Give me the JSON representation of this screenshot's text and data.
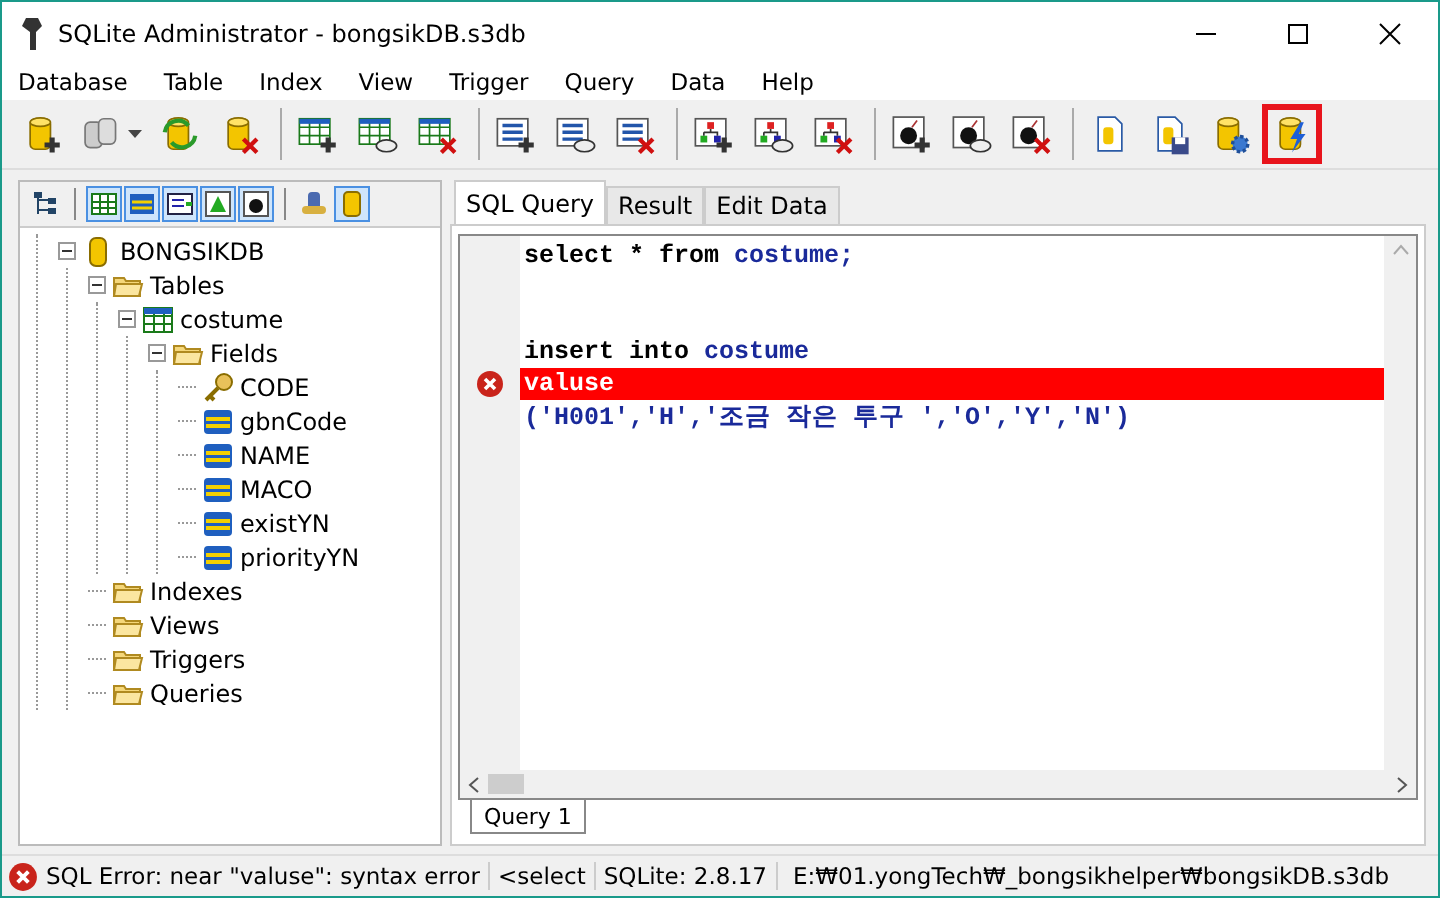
{
  "window": {
    "title": "SQLite Administrator - bongsikDB.s3db"
  },
  "menu": [
    "Database",
    "Table",
    "Index",
    "View",
    "Trigger",
    "Query",
    "Data",
    "Help"
  ],
  "toolbar": [
    {
      "kind": "db-add",
      "dropdown": false,
      "highlighted": false
    },
    {
      "kind": "dbs-none",
      "dropdown": true,
      "highlighted": false
    },
    {
      "kind": "db-refresh",
      "dropdown": false,
      "highlighted": false
    },
    {
      "kind": "db-delete",
      "dropdown": false,
      "highlighted": false
    },
    {
      "kind": "separator"
    },
    {
      "kind": "table-add",
      "dropdown": false,
      "highlighted": false
    },
    {
      "kind": "table-edit",
      "dropdown": false,
      "highlighted": false
    },
    {
      "kind": "table-delete",
      "dropdown": false,
      "highlighted": false
    },
    {
      "kind": "separator"
    },
    {
      "kind": "list-add",
      "dropdown": false,
      "highlighted": false
    },
    {
      "kind": "list-edit",
      "dropdown": false,
      "highlighted": false
    },
    {
      "kind": "list-delete",
      "dropdown": false,
      "highlighted": false
    },
    {
      "kind": "separator"
    },
    {
      "kind": "tree-add",
      "dropdown": false,
      "highlighted": false
    },
    {
      "kind": "tree-edit",
      "dropdown": false,
      "highlighted": false
    },
    {
      "kind": "tree-delete",
      "dropdown": false,
      "highlighted": false
    },
    {
      "kind": "separator"
    },
    {
      "kind": "bomb-add",
      "dropdown": false,
      "highlighted": false
    },
    {
      "kind": "bomb-edit",
      "dropdown": false,
      "highlighted": false
    },
    {
      "kind": "bomb-delete",
      "dropdown": false,
      "highlighted": false
    },
    {
      "kind": "separator"
    },
    {
      "kind": "doc-none",
      "dropdown": false,
      "highlighted": false
    },
    {
      "kind": "doc-save",
      "dropdown": false,
      "highlighted": false
    },
    {
      "kind": "db-gear",
      "dropdown": false,
      "highlighted": false
    },
    {
      "kind": "db-bolt",
      "dropdown": false,
      "highlighted": true
    }
  ],
  "sidebar": {
    "toolbar": [
      {
        "kind": "tree",
        "pressed": false
      },
      {
        "kind": "separator"
      },
      {
        "kind": "table",
        "pressed": true
      },
      {
        "kind": "field",
        "pressed": true
      },
      {
        "kind": "list",
        "pressed": true
      },
      {
        "kind": "triangle",
        "pressed": true
      },
      {
        "kind": "bomb",
        "pressed": true
      },
      {
        "kind": "separator"
      },
      {
        "kind": "robot",
        "pressed": false
      },
      {
        "kind": "db",
        "pressed": true
      }
    ],
    "tree": [
      {
        "label": "BONGSIKDB",
        "kind": "database",
        "expanded": true,
        "children": [
          {
            "label": "Tables",
            "kind": "folder",
            "expanded": true,
            "children": [
              {
                "label": "costume",
                "kind": "table",
                "expanded": true,
                "children": [
                  {
                    "label": "Fields",
                    "kind": "folder",
                    "expanded": true,
                    "children": [
                      {
                        "label": "CODE",
                        "kind": "key"
                      },
                      {
                        "label": "gbnCode",
                        "kind": "field"
                      },
                      {
                        "label": "NAME",
                        "kind": "field"
                      },
                      {
                        "label": "MACO",
                        "kind": "field"
                      },
                      {
                        "label": "existYN",
                        "kind": "field"
                      },
                      {
                        "label": "priorityYN",
                        "kind": "field"
                      }
                    ]
                  }
                ]
              }
            ]
          },
          {
            "label": "Indexes",
            "kind": "folder"
          },
          {
            "label": "Views",
            "kind": "folder"
          },
          {
            "label": "Triggers",
            "kind": "folder"
          },
          {
            "label": "Queries",
            "kind": "folder"
          }
        ]
      }
    ]
  },
  "tabs": [
    {
      "label": "SQL Query",
      "selected": true
    },
    {
      "label": "Result",
      "selected": false
    },
    {
      "label": "Edit Data",
      "selected": false
    }
  ],
  "editor": {
    "lines": [
      {
        "error": false,
        "segments": [
          {
            "kind": "keyword",
            "text": "select * from "
          },
          {
            "kind": "ident",
            "text": "costume;"
          }
        ]
      },
      {
        "error": false
      },
      {
        "error": false
      },
      {
        "error": false,
        "segments": [
          {
            "kind": "keyword",
            "text": "insert into "
          },
          {
            "kind": "ident",
            "text": "costume"
          }
        ]
      },
      {
        "error": true,
        "segments": [
          {
            "kind": "keyword",
            "text": "valuse"
          }
        ]
      },
      {
        "error": false,
        "segments": [
          {
            "kind": "ident",
            "text": "('H001','H','조금 작은 투구 ','O','Y','N')"
          }
        ]
      }
    ]
  },
  "query_tabs": [
    {
      "label": "Query 1",
      "selected": true
    }
  ],
  "status_bar": {
    "error": true,
    "message": "SQL Error: near \"valuse\": syntax error",
    "query": "<select",
    "version": "SQLite: 2.8.17",
    "path": "E:₩01.yongTech₩_bongsikhelper₩bongsikDB.s3db"
  }
}
